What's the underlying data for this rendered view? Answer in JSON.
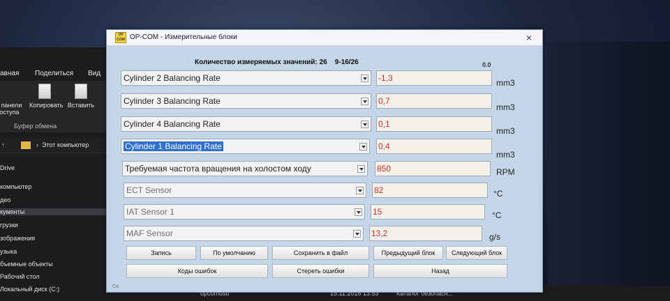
{
  "explorer": {
    "ribbon_tabs": [
      "авная",
      "Поделиться",
      "Вид"
    ],
    "tools": [
      {
        "label": "а панели\nдоступа"
      },
      {
        "label": "Копировать"
      },
      {
        "label": "Вставить"
      }
    ],
    "clipboard_group": "Буфер обмена",
    "address": "Этот компьютер",
    "address_sep": "›",
    "nav": [
      "Drive",
      "компьютер",
      "део",
      "кументы",
      "грузки",
      "зображения",
      "узыка",
      "бъемные объекты",
      "Рабочий стол",
      "Локальный диск (C:)"
    ],
    "file_row": {
      "name": "opcomusb",
      "date": "15.11.2016 13:53",
      "type": "Каталог безопасн..."
    }
  },
  "window": {
    "title": "OP-COM - Измерительные блоки",
    "icon_text": "OP COM",
    "close": "×"
  },
  "header": {
    "label": "Количество измеряемых значений: 26",
    "range": "9-16/26",
    "right_value": "0.0"
  },
  "rows": [
    {
      "name": "Cylinder 2 Balancing Rate",
      "value": "-1,3",
      "unit": "mm3",
      "highlighted": false,
      "dim": false
    },
    {
      "name": "Cylinder 3 Balancing Rate",
      "value": "0,7",
      "unit": "mm3",
      "highlighted": false,
      "dim": false
    },
    {
      "name": "Cylinder 4 Balancing Rate",
      "value": "0,1",
      "unit": "mm3",
      "highlighted": false,
      "dim": false
    },
    {
      "name": "Cylinder 1 Balancing Rate",
      "value": "0,4",
      "unit": "mm3",
      "highlighted": true,
      "dim": false
    },
    {
      "name": "Требуемая частота вращения на холостом ходу",
      "value": "850",
      "unit": "RPM",
      "highlighted": false,
      "dim": false
    },
    {
      "name": "ECT Sensor",
      "value": "82",
      "unit": "°C",
      "highlighted": false,
      "dim": true
    },
    {
      "name": "IAT Sensor 1",
      "value": "15",
      "unit": "°C",
      "highlighted": false,
      "dim": true
    },
    {
      "name": "MAF Sensor",
      "value": "13,2",
      "unit": "g/s",
      "highlighted": false,
      "dim": true
    }
  ],
  "buttons": {
    "record": "Запись",
    "defaults": "По умолчанию",
    "save_file": "Сохранить в файл",
    "prev_block": "Предыдущий блок",
    "next_block": "Следующий блок",
    "error_codes": "Коды ошибок",
    "clear_errors": "Стереть ошибки",
    "back": "Назад"
  },
  "status_fragment": "Co",
  "colors": {
    "value_text": "#d03020",
    "selection": "#2f6fd0",
    "window_bg": "#c4d6e7"
  }
}
